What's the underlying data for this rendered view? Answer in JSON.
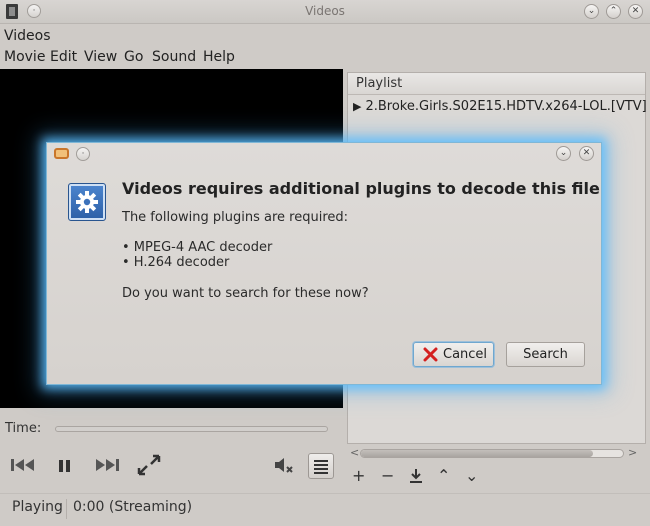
{
  "window": {
    "title": "Videos",
    "app_name": "Videos",
    "minimize_glyph": "⌄",
    "maximize_glyph": "⌃",
    "close_glyph": "✕",
    "round_glyph": "·"
  },
  "menu": [
    "Movie",
    "Edit",
    "View",
    "Go",
    "Sound",
    "Help"
  ],
  "sidebar": {
    "header": "Playlist",
    "items": [
      {
        "play_glyph": "▶",
        "label": "2.Broke.Girls.S02E15.HDTV.x264-LOL.[VTV]"
      }
    ],
    "scroll_left": "<",
    "scroll_right": ">",
    "tools": {
      "add": "+",
      "remove": "−",
      "save_icon": "download-icon",
      "up": "⌃",
      "down": "⌄"
    }
  },
  "player": {
    "time_label": "Time:",
    "status": "Playing",
    "stream_info": "0:00 (Streaming)"
  },
  "dialog": {
    "minimize_glyph": "⌄",
    "close_glyph": "✕",
    "heading": "Videos requires additional plugins to decode this file",
    "required_text": "The following plugins are required:",
    "plugins": [
      "• MPEG-4 AAC decoder",
      "• H.264 decoder"
    ],
    "question": "Do you want to search for these now?",
    "cancel_label": "Cancel",
    "search_label": "Search"
  },
  "colors": {
    "dialog_glow": "#5abeff",
    "settings_icon": "#2c5fa6",
    "cancel_x": "#d42020",
    "video_bg": "#000000"
  }
}
